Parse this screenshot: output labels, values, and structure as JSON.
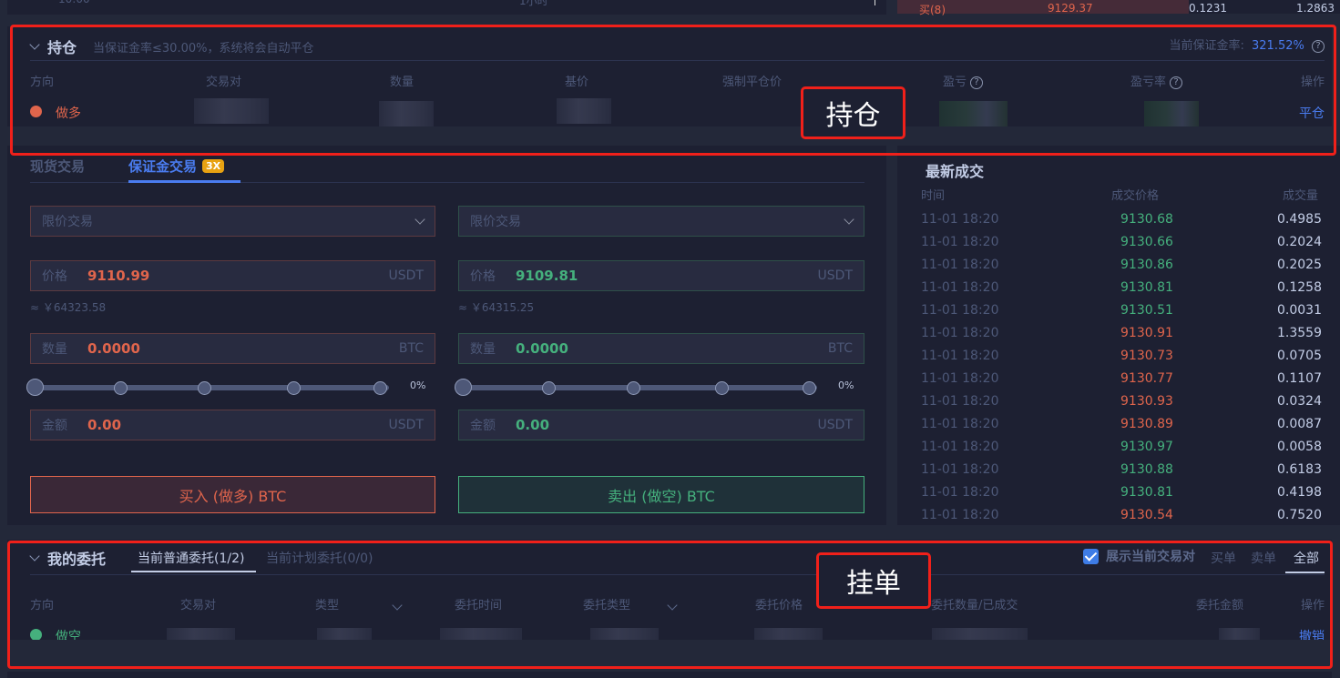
{
  "orderbook_top": {
    "left_partial_time": "10:00",
    "left_partial_mid": "1小时",
    "ask_row": {
      "label": "买(8)",
      "price": "9129.37",
      "amount": "0.1231",
      "total": "1.2863"
    }
  },
  "positions": {
    "title": "持仓",
    "note": "当保证金率≤30.00%，系统将会自动平仓",
    "margin_rate_label": "当前保证金率:",
    "margin_rate_value": "321.52%",
    "columns": [
      "方向",
      "交易对",
      "数量",
      "基价",
      "强制平仓价",
      "盈亏",
      "盈亏率",
      "操作"
    ],
    "rows": [
      {
        "direction": "做多",
        "action": "平仓"
      }
    ]
  },
  "order_form": {
    "tabs": [
      {
        "label": "现货交易",
        "active": false
      },
      {
        "label": "保证金交易",
        "active": true,
        "badge": "3X"
      }
    ],
    "buy": {
      "order_type": "限价交易",
      "price_label": "价格",
      "price": "9110.99",
      "price_unit": "USDT",
      "approx": "≈ ￥64323.58",
      "amount_label": "数量",
      "amount": "0.0000",
      "amount_unit": "BTC",
      "slider_percent": "0%",
      "total_label": "金额",
      "total": "0.00",
      "total_unit": "USDT",
      "button": "买入 (做多) BTC"
    },
    "sell": {
      "order_type": "限价交易",
      "price_label": "价格",
      "price": "9109.81",
      "price_unit": "USDT",
      "approx": "≈ ￥64315.25",
      "amount_label": "数量",
      "amount": "0.0000",
      "amount_unit": "BTC",
      "slider_percent": "0%",
      "total_label": "金额",
      "total": "0.00",
      "total_unit": "USDT",
      "button": "卖出 (做空) BTC"
    }
  },
  "trades": {
    "title": "最新成交",
    "columns": [
      "时间",
      "成交价格",
      "成交量"
    ],
    "rows": [
      {
        "time": "11-01 18:20",
        "price": "9130.68",
        "qty": "0.4985",
        "side": "buy"
      },
      {
        "time": "11-01 18:20",
        "price": "9130.66",
        "qty": "0.2024",
        "side": "buy"
      },
      {
        "time": "11-01 18:20",
        "price": "9130.86",
        "qty": "0.2025",
        "side": "buy"
      },
      {
        "time": "11-01 18:20",
        "price": "9130.81",
        "qty": "0.1258",
        "side": "buy"
      },
      {
        "time": "11-01 18:20",
        "price": "9130.51",
        "qty": "0.0031",
        "side": "buy"
      },
      {
        "time": "11-01 18:20",
        "price": "9130.91",
        "qty": "1.3559",
        "side": "sell"
      },
      {
        "time": "11-01 18:20",
        "price": "9130.73",
        "qty": "0.0705",
        "side": "sell"
      },
      {
        "time": "11-01 18:20",
        "price": "9130.77",
        "qty": "0.1107",
        "side": "sell"
      },
      {
        "time": "11-01 18:20",
        "price": "9130.93",
        "qty": "0.0324",
        "side": "sell"
      },
      {
        "time": "11-01 18:20",
        "price": "9130.89",
        "qty": "0.0087",
        "side": "sell"
      },
      {
        "time": "11-01 18:20",
        "price": "9130.97",
        "qty": "0.0058",
        "side": "buy"
      },
      {
        "time": "11-01 18:20",
        "price": "9130.88",
        "qty": "0.6183",
        "side": "buy"
      },
      {
        "time": "11-01 18:20",
        "price": "9130.81",
        "qty": "0.4198",
        "side": "buy"
      },
      {
        "time": "11-01 18:20",
        "price": "9130.54",
        "qty": "0.7520",
        "side": "sell"
      }
    ]
  },
  "orders": {
    "title": "我的委托",
    "tabs": [
      {
        "label": "当前普通委托(1/2)",
        "active": true
      },
      {
        "label": "当前计划委托(0/0)",
        "active": false
      }
    ],
    "show_current_pair_label": "展示当前交易对",
    "show_current_pair_checked": true,
    "filters": [
      {
        "label": "买单",
        "active": false
      },
      {
        "label": "卖单",
        "active": false
      },
      {
        "label": "全部",
        "active": true
      }
    ],
    "columns": [
      "方向",
      "交易对",
      "类型",
      "委托时间",
      "委托类型",
      "委托价格",
      "委托数量/已成交",
      "委托金额",
      "操作"
    ],
    "rows": [
      {
        "direction": "做空",
        "action": "撤销"
      }
    ]
  },
  "annotations": {
    "positions_label": "持仓",
    "orders_label": "挂单"
  },
  "colors": {
    "up": "#45b07d",
    "down": "#e0654c",
    "accent": "#4a7cf0",
    "badge": "#e8a212",
    "annotation": "#f0201a"
  }
}
